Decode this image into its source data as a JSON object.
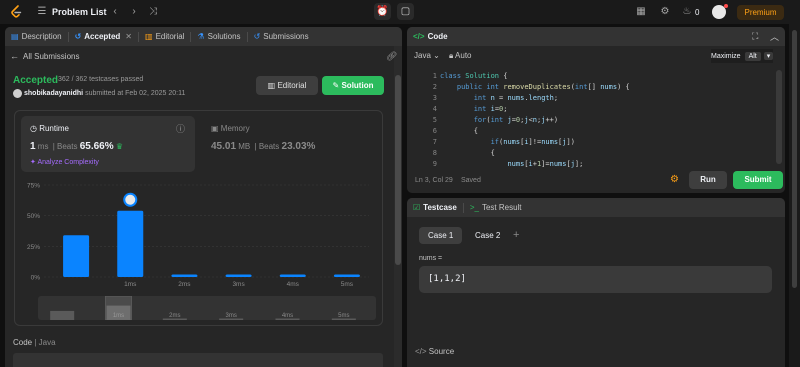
{
  "topbar": {
    "problem_list": "Problem List",
    "streak_count": "0",
    "premium": "Premium"
  },
  "left_tabs": [
    {
      "label": "Description",
      "icon": "description-icon"
    },
    {
      "label": "Accepted",
      "icon": "history-icon"
    },
    {
      "label": "Editorial",
      "icon": "book-icon"
    },
    {
      "label": "Solutions",
      "icon": "flask-icon"
    },
    {
      "label": "Submissions",
      "icon": "history-icon"
    }
  ],
  "submission": {
    "back_label": "All Submissions",
    "status": "Accepted",
    "testcases": "362 / 362 testcases passed",
    "username": "shobikadayanidhi",
    "submitted_text": "submitted at Feb 02, 2025 20:11",
    "editorial_btn": "Editorial",
    "solution_btn": "Solution"
  },
  "runtime": {
    "title": "Runtime",
    "value": "1",
    "unit": "ms",
    "beats_label": "Beats",
    "beats_value": "65.66%",
    "analyze": "Analyze Complexity"
  },
  "memory": {
    "title": "Memory",
    "value": "45.01",
    "unit": "MB",
    "beats_label": "Beats",
    "beats_value": "23.03%"
  },
  "chart_data": {
    "type": "bar",
    "categories": [
      "",
      "1ms",
      "2ms",
      "3ms",
      "4ms",
      "5ms"
    ],
    "values": [
      34,
      54,
      1,
      1,
      1,
      1
    ],
    "y_tick_labels": [
      "75%",
      "50%",
      "25%",
      "0%"
    ],
    "ylim": [
      0,
      75
    ],
    "highlight_index": 1,
    "bar_color": "#0a84ff",
    "grid": true
  },
  "minimap_labels": [
    "1ms",
    "2ms",
    "3ms",
    "4ms",
    "5ms"
  ],
  "code_section": {
    "label": "Code",
    "lang": "Java"
  },
  "editor": {
    "title": "Code",
    "language": "Java",
    "auto": "Auto",
    "maximize": "Maximize",
    "alt": "Alt",
    "status_pos": "Ln 3, Col 29",
    "status_saved": "Saved",
    "run": "Run",
    "submit": "Submit"
  },
  "code_lines": [
    {
      "n": "1",
      "text": "class Solution {"
    },
    {
      "n": "2",
      "text": "    public int removeDuplicates(int[] nums) {"
    },
    {
      "n": "3",
      "text": "        int n = nums.length;"
    },
    {
      "n": "4",
      "text": "        int i=0;"
    },
    {
      "n": "5",
      "text": "        for(int j=0;j<n;j++)"
    },
    {
      "n": "6",
      "text": "        {"
    },
    {
      "n": "7",
      "text": "            if(nums[i]!=nums[j])"
    },
    {
      "n": "8",
      "text": "            {"
    },
    {
      "n": "9",
      "text": "                nums[i+1]=nums[j];"
    }
  ],
  "testcase": {
    "tab_testcase": "Testcase",
    "tab_result": "Test Result",
    "case1": "Case 1",
    "case2": "Case 2",
    "add": "+",
    "param_name": "nums =",
    "param_value": "[1,1,2]",
    "source": "Source"
  },
  "colors": {
    "accent_green": "#2cbb5d",
    "brand_orange": "#ffa116",
    "bar_blue": "#0a84ff"
  }
}
